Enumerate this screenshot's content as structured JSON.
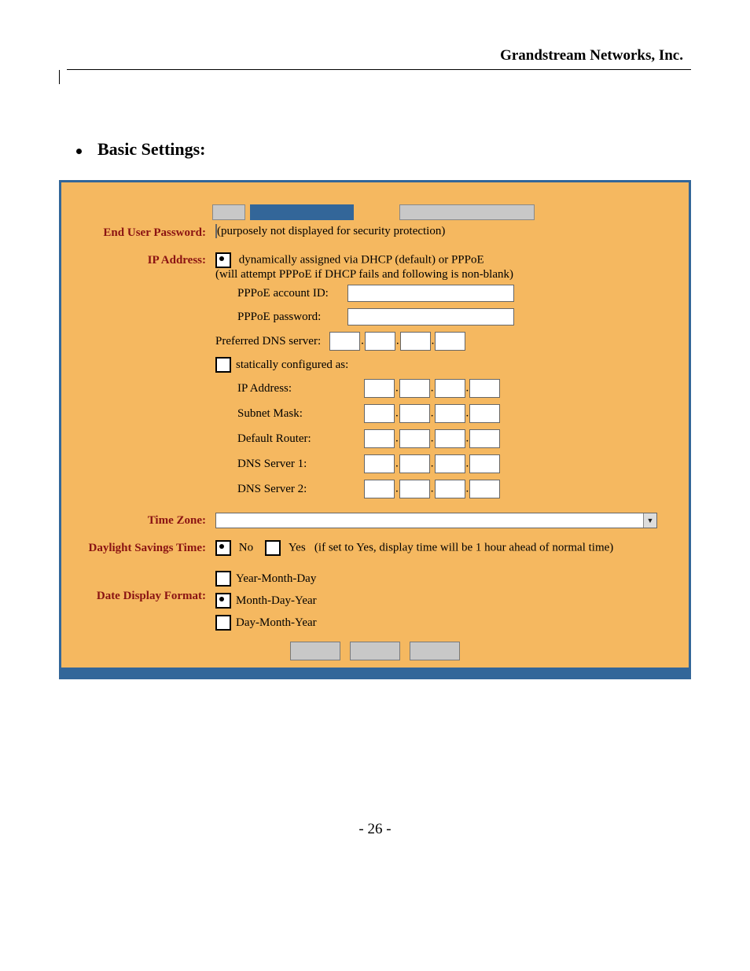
{
  "company": "Grandstream Networks, Inc.",
  "section_heading": "Basic Settings:",
  "labels": {
    "end_user_password": "End User Password:",
    "ip_address": "IP Address:",
    "time_zone": "Time Zone:",
    "dst": "Daylight Savings Time:",
    "date_format": "Date Display Format:"
  },
  "pwd_note": "(purposely not displayed for security protection)",
  "ip": {
    "dhcp_line1": "dynamically assigned via DHCP (default) or PPPoE",
    "dhcp_line2": "(will attempt PPPoE if DHCP fails and following is non-blank)",
    "pppoe_id": "PPPoE account ID:",
    "pppoe_pw": "PPPoE password:",
    "pref_dns": "Preferred DNS server:",
    "static": "statically configured as:",
    "ip_addr": "IP  Address:",
    "subnet": "Subnet Mask:",
    "router": "Default Router:",
    "dns1": "DNS  Server 1:",
    "dns2": "DNS  Server 2:"
  },
  "dst": {
    "no": "No",
    "yes": "Yes",
    "note": "(if set to Yes, display time will be 1 hour ahead of normal time)"
  },
  "date_format": {
    "ymd": "Year-Month-Day",
    "mdy": "Month-Day-Year",
    "dmy": "Day-Month-Year"
  },
  "page_number": "- 26 -"
}
